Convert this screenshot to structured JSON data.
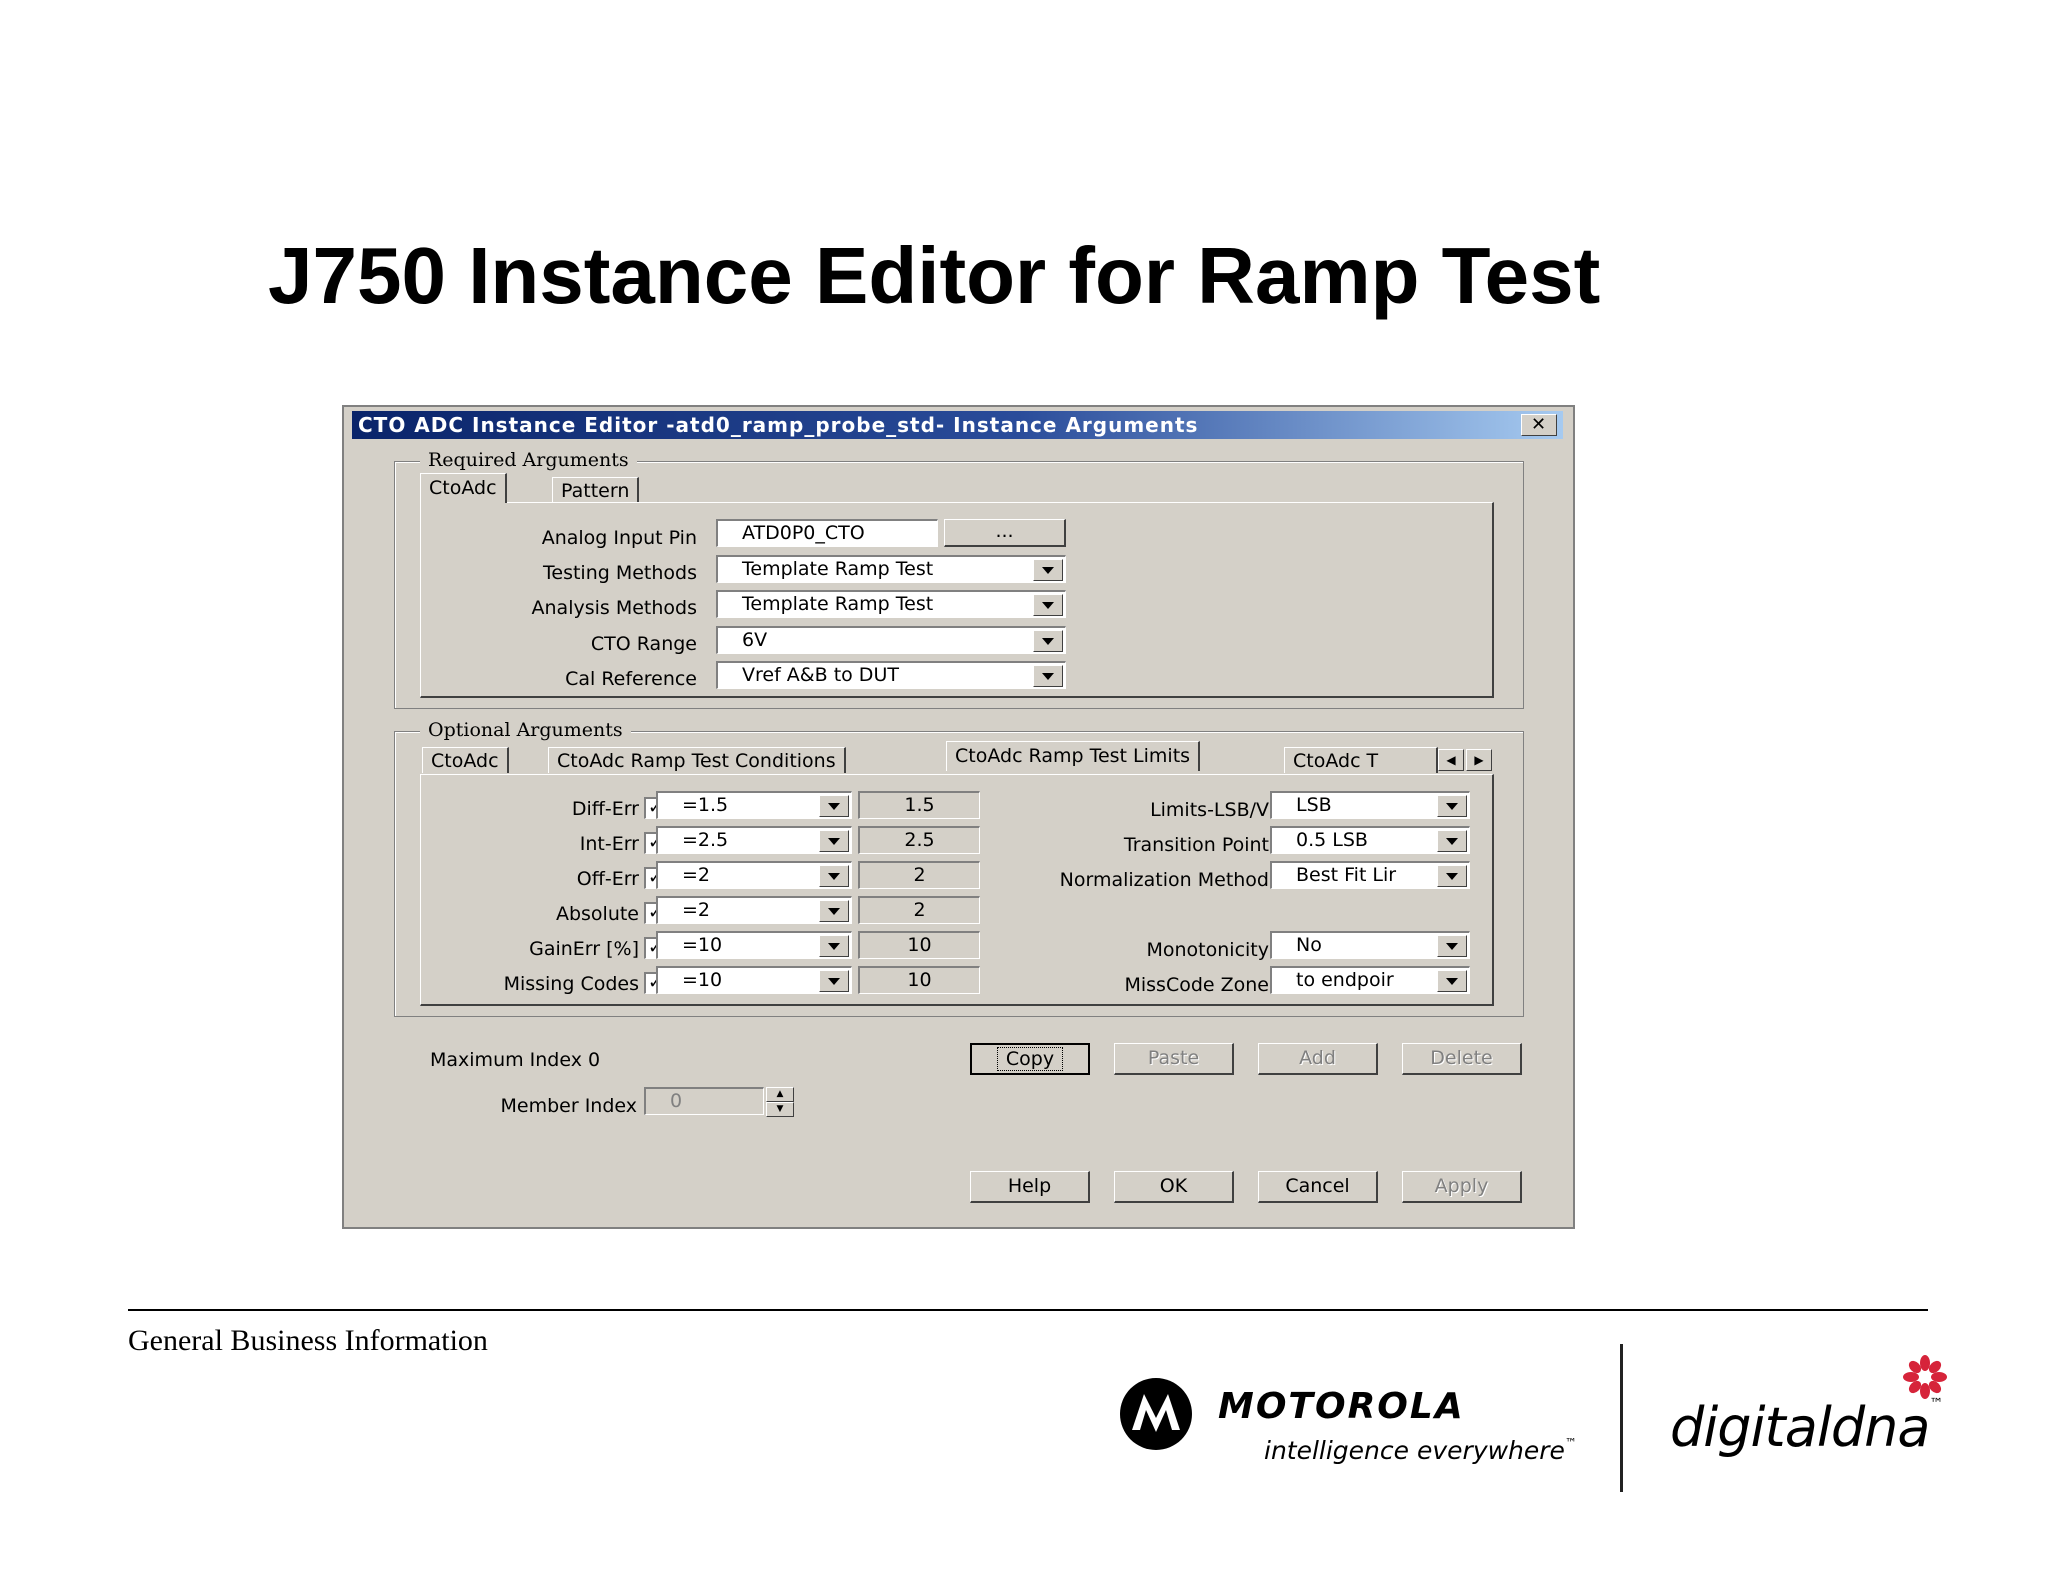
{
  "slide": {
    "title": "J750 Instance Editor for Ramp Test",
    "footer": "General Business Information"
  },
  "dialog": {
    "title": "CTO ADC Instance Editor -atd0_ramp_probe_std- Instance Arguments",
    "close_glyph": "✕",
    "required": {
      "group_label": "Required Arguments",
      "tabs": [
        "CtoAdc",
        "Pattern"
      ],
      "active_tab": "CtoAdc",
      "fields": [
        {
          "label": "Analog Input Pin",
          "value": "ATD0P0_CTO",
          "browse_label": "..."
        },
        {
          "label": "Testing Methods",
          "value": "Template Ramp Test"
        },
        {
          "label": "Analysis Methods",
          "value": "Template Ramp Test"
        },
        {
          "label": "CTO Range",
          "value": "6V"
        },
        {
          "label": "Cal Reference",
          "value": "Vref A&B to DUT"
        }
      ]
    },
    "optional": {
      "group_label": "Optional Arguments",
      "tabs": [
        "CtoAdc",
        "CtoAdc Ramp Test Conditions",
        "CtoAdc Ramp Test Limits",
        "CtoAdc T"
      ],
      "active_tab": "CtoAdc Ramp Test Limits",
      "limits": [
        {
          "label": "Diff-Err",
          "checked": true,
          "select": "=1.5",
          "value": "1.5"
        },
        {
          "label": "Int-Err",
          "checked": true,
          "select": "=2.5",
          "value": "2.5"
        },
        {
          "label": "Off-Err",
          "checked": true,
          "select": "=2",
          "value": "2"
        },
        {
          "label": "Absolute",
          "checked": true,
          "select": "=2",
          "value": "2"
        },
        {
          "label": "GainErr [%]",
          "checked": true,
          "select": "=10",
          "value": "10"
        },
        {
          "label": "Missing Codes",
          "checked": true,
          "select": "=10",
          "value": "10"
        }
      ],
      "right_fields": [
        {
          "label": "Limits-LSB/V",
          "value": "LSB"
        },
        {
          "label": "Transition Point",
          "value": "0.5 LSB"
        },
        {
          "label": "Normalization Method",
          "value": "Best Fit Lir"
        },
        {
          "label": "Monotonicity",
          "value": "No"
        },
        {
          "label": "MissCode Zone",
          "value": "to endpoir"
        }
      ]
    },
    "max_index_label": "Maximum Index 0",
    "member_index_label": "Member Index",
    "member_index_value": "0",
    "edit_buttons": {
      "copy": "Copy",
      "paste": "Paste",
      "add": "Add",
      "delete": "Delete"
    },
    "bottom_buttons": {
      "help": "Help",
      "ok": "OK",
      "cancel": "Cancel",
      "apply": "Apply"
    }
  },
  "logos": {
    "motorola_word": "MOTOROLA",
    "motorola_tagline": "intelligence everywhere",
    "digitaldna_word": "digitaldna",
    "digitaldna_tm": "™",
    "motorola_tm": "™"
  },
  "colors": {
    "dialog_bg": "#d4d0c8",
    "titlebar": "#0a246a",
    "ddna_star": "#d6243a"
  }
}
